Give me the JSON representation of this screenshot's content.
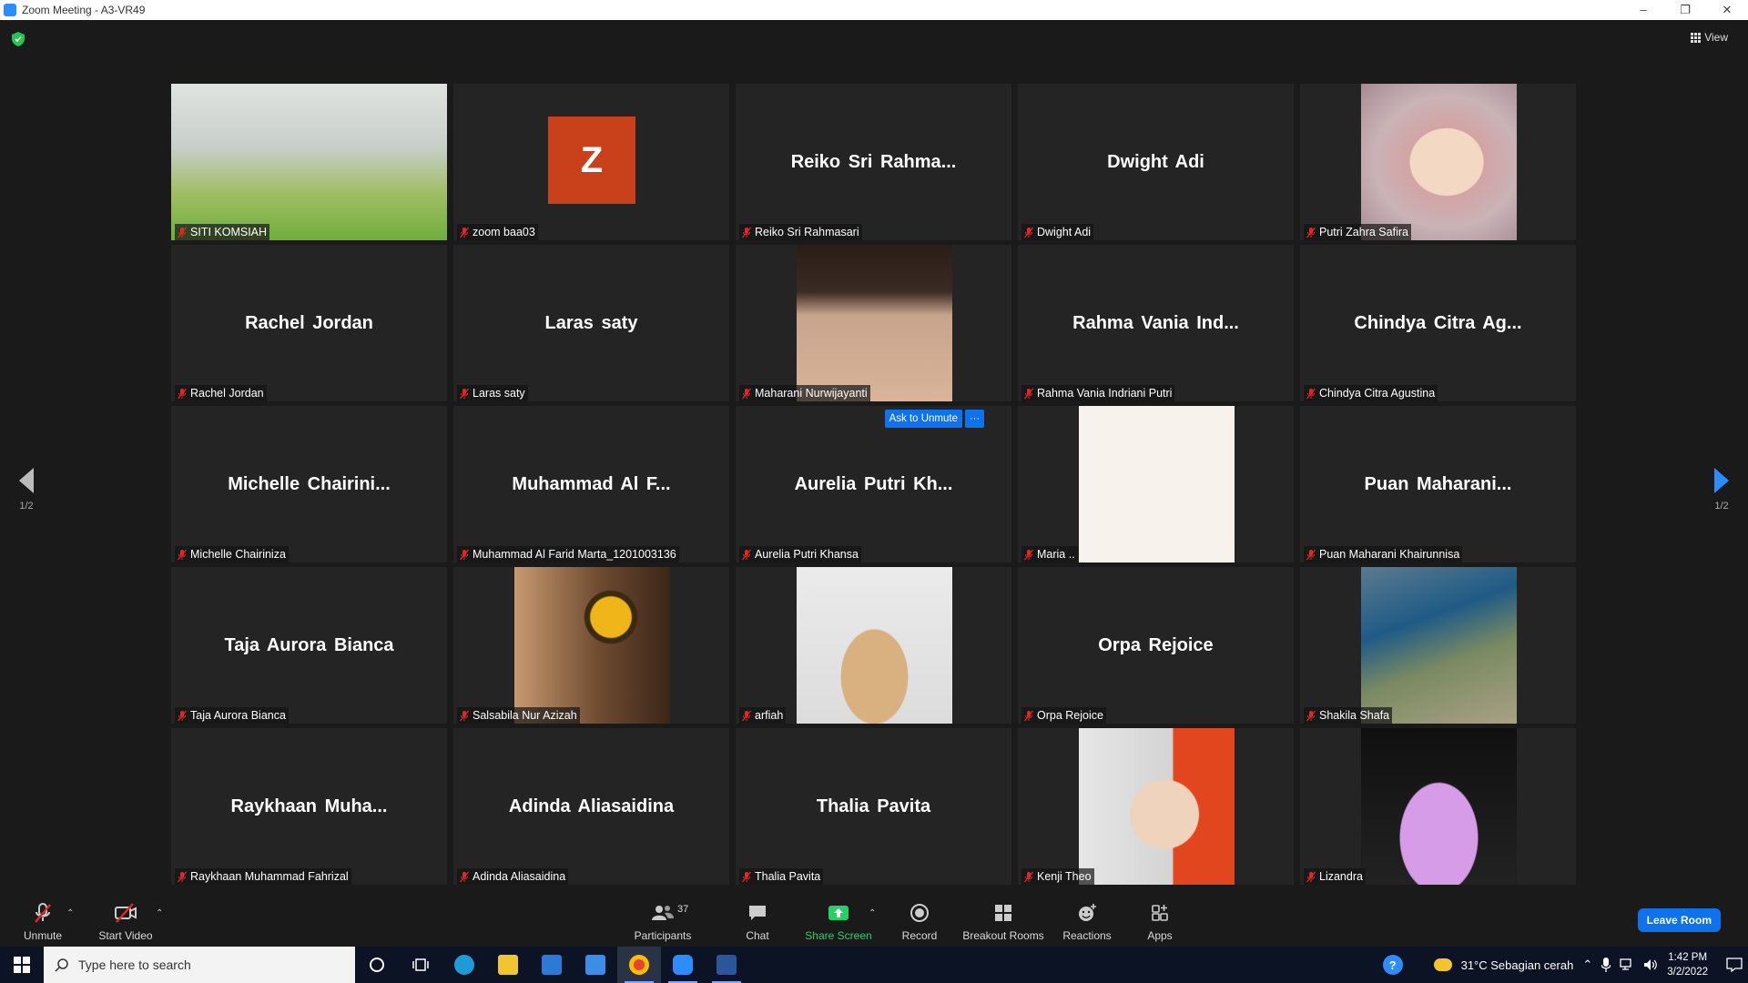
{
  "window": {
    "title": "Zoom Meeting - A3-VR49"
  },
  "meeting": {
    "view_label": "View",
    "ask_to_unmute": "Ask to Unmute",
    "more_label": "···",
    "page_indicator_left": "1/2",
    "page_indicator_right": "1/2",
    "colors": {
      "background": "#1a1a1a",
      "tile": "#242424",
      "accent": "#0e72ed",
      "avatar": "#c8411b"
    }
  },
  "participants": [
    {
      "big": "",
      "label": "SITI KOMSIAH",
      "video": "photo-green"
    },
    {
      "big": "",
      "avatar_letter": "Z",
      "label": "zoom baa03"
    },
    {
      "big": "Reiko Sri Rahma...",
      "label": "Reiko Sri Rahmasari"
    },
    {
      "big": "Dwight Adi",
      "label": "Dwight Adi"
    },
    {
      "big": "",
      "label": "Putri Zahra Safira",
      "video": "photo-hijab"
    },
    {
      "big": "Rachel Jordan",
      "label": "Rachel Jordan"
    },
    {
      "big": "Laras saty",
      "label": "Laras saty"
    },
    {
      "big": "",
      "label": "Maharani Nurwijayanti",
      "video": "photo-eyes"
    },
    {
      "big": "Rahma Vania Ind...",
      "label": "Rahma Vania Indriani Putri"
    },
    {
      "big": "Chindya Citra Ag...",
      "label": "Chindya Citra Agustina"
    },
    {
      "big": "Michelle Chairini...",
      "label": "Michelle Chairiniza"
    },
    {
      "big": "Muhammad Al F...",
      "label": "Muhammad Al Farid Marta_1201003136"
    },
    {
      "big": "Aurelia Putri Kh...",
      "label": "Aurelia Putri Khansa"
    },
    {
      "big": "",
      "label": "Maria ..",
      "video": "photo-blank"
    },
    {
      "big": "Puan Maharani...",
      "label": "Puan Maharani Khairunnisa"
    },
    {
      "big": "Taja Aurora Bianca",
      "label": "Taja Aurora Bianca"
    },
    {
      "big": "",
      "label": "Salsabila Nur Azizah",
      "video": "photo-sunflower"
    },
    {
      "big": "",
      "label": "arfiah",
      "video": "photo-teddy"
    },
    {
      "big": "Orpa Rejoice",
      "label": "Orpa Rejoice"
    },
    {
      "big": "",
      "label": "Shakila Shafa",
      "video": "photo-coast"
    },
    {
      "big": "Raykhaan Muha...",
      "label": "Raykhaan Muhammad Fahrizal"
    },
    {
      "big": "Adinda Aliasaidina",
      "label": "Adinda Aliasaidina"
    },
    {
      "big": "Thalia Pavita",
      "label": "Thalia Pavita"
    },
    {
      "big": "",
      "label": "Kenji Theo",
      "video": "photo-cap"
    },
    {
      "big": "",
      "label": "Lizandra",
      "video": "photo-dress"
    }
  ],
  "toolbar": {
    "unmute": "Unmute",
    "start_video": "Start Video",
    "participants": "Participants",
    "participant_count": "37",
    "chat": "Chat",
    "share_screen": "Share Screen",
    "record": "Record",
    "breakout_rooms": "Breakout Rooms",
    "reactions": "Reactions",
    "apps": "Apps",
    "leave": "Leave Room"
  },
  "taskbar": {
    "search_placeholder": "Type here to search",
    "weather": "31°C  Sebagian cerah",
    "time": "1:42 PM",
    "date": "3/2/2022"
  }
}
